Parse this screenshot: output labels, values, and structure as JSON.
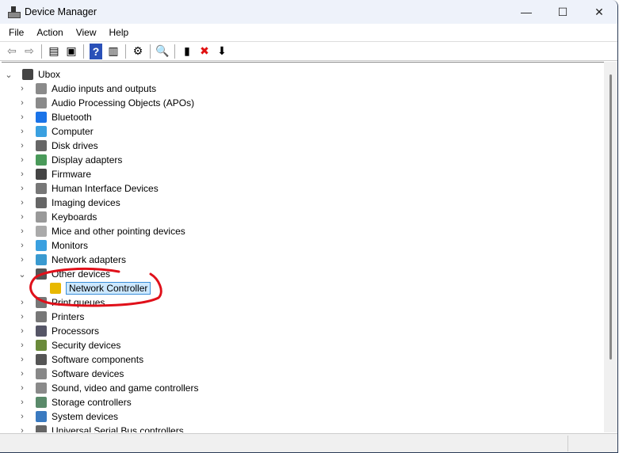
{
  "window": {
    "title": "Device Manager",
    "minimize": "—",
    "maximize": "☐",
    "close": "✕"
  },
  "menu": [
    "File",
    "Action",
    "View",
    "Help"
  ],
  "toolbar": [
    {
      "name": "back-icon",
      "glyph": "⇦"
    },
    {
      "name": "forward-icon",
      "glyph": "⇨"
    },
    {
      "name": "show-hide-console-tree-icon",
      "glyph": "▤"
    },
    {
      "name": "properties-icon",
      "glyph": "▣"
    },
    {
      "name": "help-icon",
      "glyph": "?"
    },
    {
      "name": "show-action-pane-icon",
      "glyph": "▥"
    },
    {
      "name": "update-driver-icon",
      "glyph": "⚙"
    },
    {
      "name": "scan-hardware-icon",
      "glyph": "🔍"
    },
    {
      "name": "enable-device-icon",
      "glyph": "▮"
    },
    {
      "name": "uninstall-icon",
      "glyph": "✖"
    },
    {
      "name": "disable-icon",
      "glyph": "⬇"
    }
  ],
  "tree": {
    "root": "Ubox",
    "items": [
      {
        "label": "Audio inputs and outputs",
        "color": "#8a8a8a"
      },
      {
        "label": "Audio Processing Objects (APOs)",
        "color": "#8a8a8a"
      },
      {
        "label": "Bluetooth",
        "color": "#1a73e8"
      },
      {
        "label": "Computer",
        "color": "#3aa0e0"
      },
      {
        "label": "Disk drives",
        "color": "#666"
      },
      {
        "label": "Display adapters",
        "color": "#4a9a5a"
      },
      {
        "label": "Firmware",
        "color": "#444"
      },
      {
        "label": "Human Interface Devices",
        "color": "#777"
      },
      {
        "label": "Imaging devices",
        "color": "#666"
      },
      {
        "label": "Keyboards",
        "color": "#999"
      },
      {
        "label": "Mice and other pointing devices",
        "color": "#aaa"
      },
      {
        "label": "Monitors",
        "color": "#3aa0e0"
      },
      {
        "label": "Network adapters",
        "color": "#3a9ad0"
      },
      {
        "label": "Other devices",
        "color": "#555",
        "expanded": true
      },
      {
        "label": "Network Controller",
        "color": "#e8b800",
        "child": true,
        "selected": true
      },
      {
        "label": "Print queues",
        "color": "#777"
      },
      {
        "label": "Printers",
        "color": "#777"
      },
      {
        "label": "Processors",
        "color": "#556"
      },
      {
        "label": "Security devices",
        "color": "#6a8a3a"
      },
      {
        "label": "Software components",
        "color": "#555"
      },
      {
        "label": "Software devices",
        "color": "#888"
      },
      {
        "label": "Sound, video and game controllers",
        "color": "#8a8a8a"
      },
      {
        "label": "Storage controllers",
        "color": "#5a8a6a"
      },
      {
        "label": "System devices",
        "color": "#3a7ac0"
      },
      {
        "label": "Universal Serial Bus controllers",
        "color": "#666"
      }
    ]
  },
  "colors": {
    "annotation": "#e0101a",
    "selection": "#cce8ff"
  }
}
